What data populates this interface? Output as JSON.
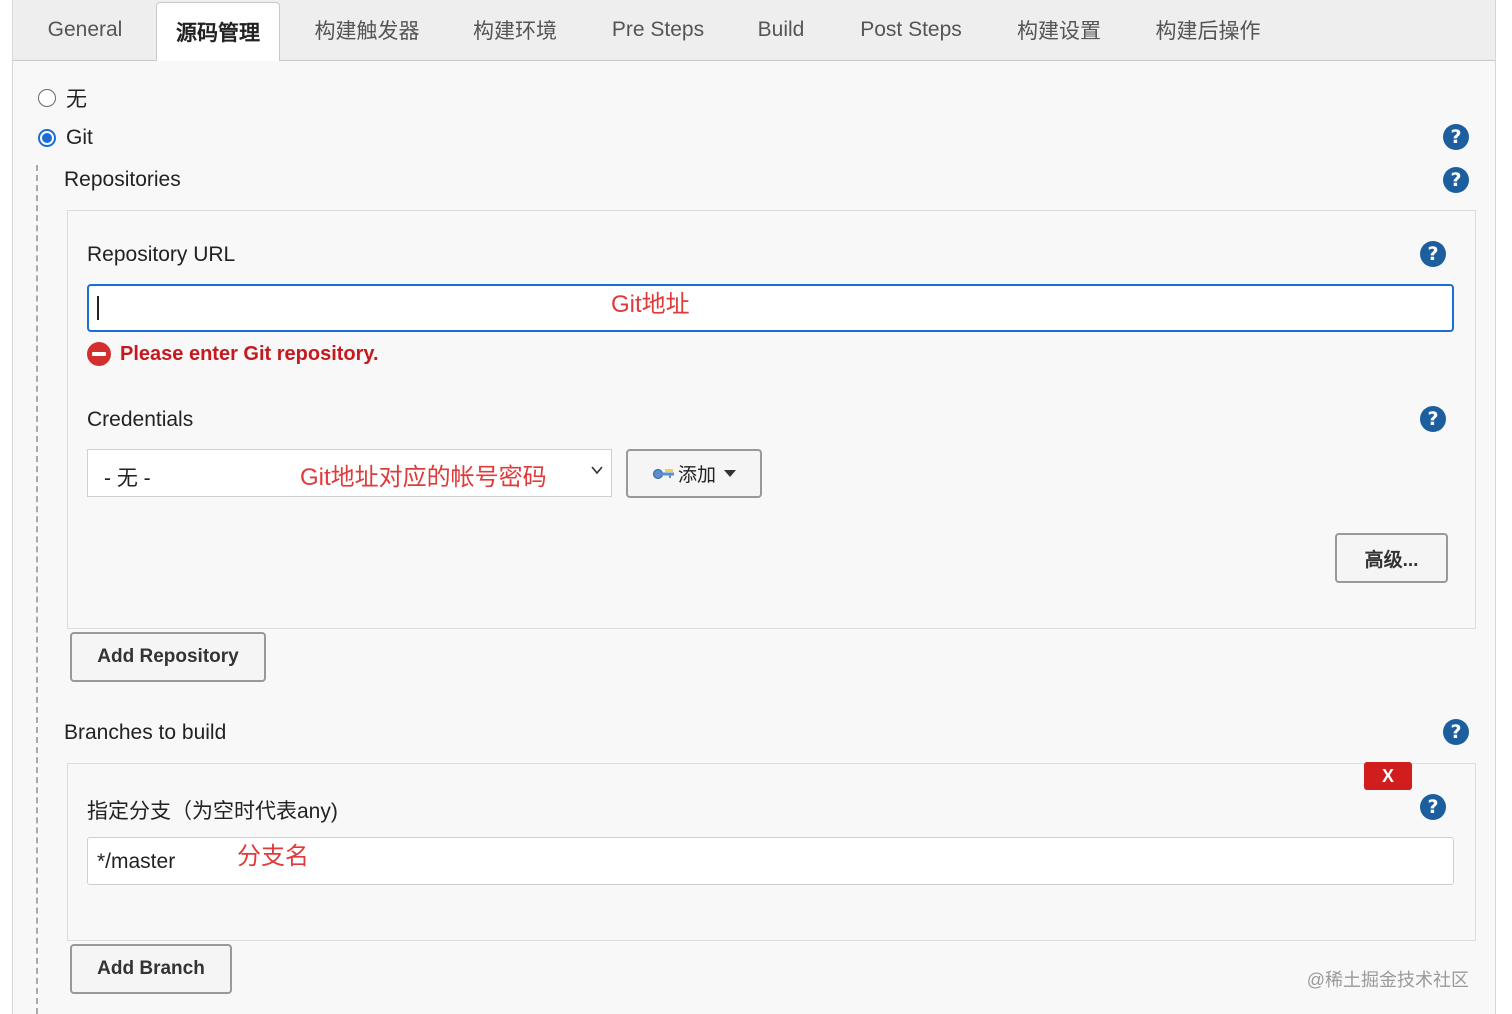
{
  "tabs": [
    {
      "label": "General"
    },
    {
      "label": "源码管理"
    },
    {
      "label": "构建触发器"
    },
    {
      "label": "构建环境"
    },
    {
      "label": "Pre Steps"
    },
    {
      "label": "Build"
    },
    {
      "label": "Post Steps"
    },
    {
      "label": "构建设置"
    },
    {
      "label": "构建后操作"
    }
  ],
  "scm": {
    "option_none": "无",
    "option_git": "Git",
    "selected": "Git"
  },
  "help_icon": "?",
  "repositories": {
    "label": "Repositories",
    "url_label": "Repository URL",
    "url_value": "",
    "url_annotation": "Git地址",
    "error": "Please enter Git repository.",
    "credentials_label": "Credentials",
    "credentials_value": "- 无 -",
    "credentials_annotation": "Git地址对应的帐号密码",
    "add_button": "添加",
    "advanced_button": "高级...",
    "add_repository_button": "Add Repository"
  },
  "branches": {
    "label": "Branches to build",
    "specifier_label": "指定分支（为空时代表any)",
    "specifier_value": "*/master",
    "specifier_annotation": "分支名",
    "delete_button": "X",
    "add_branch_button": "Add Branch"
  },
  "watermark": "@稀土掘金技术社区",
  "colors": {
    "accent": "#1a6ed8",
    "help": "#1d5f9e",
    "error": "#c4191f",
    "annotation": "#e03a3a",
    "delete": "#d11d1d"
  }
}
